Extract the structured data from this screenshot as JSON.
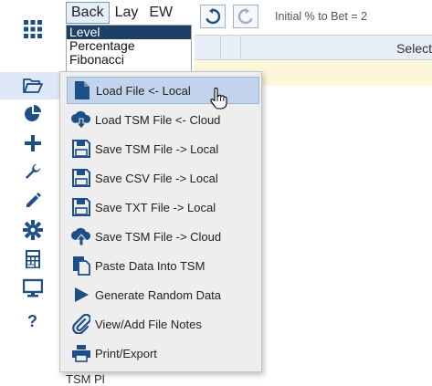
{
  "tabs": [
    {
      "label": "Back"
    },
    {
      "label": "Lay"
    },
    {
      "label": "EW"
    }
  ],
  "strategies": [
    "Level",
    "Percentage",
    "Fibonacci"
  ],
  "toolbar": {
    "initial_bet_label": "Initial % to Bet = 2"
  },
  "grid": {
    "header_select": "Select"
  },
  "menu": {
    "items": [
      {
        "label": "Load File <- Local",
        "icon": "file-icon"
      },
      {
        "label": "Load TSM File <- Cloud",
        "icon": "cloud-download-icon"
      },
      {
        "label": "Save TSM File -> Local",
        "icon": "floppy-icon"
      },
      {
        "label": "Save CSV File -> Local",
        "icon": "floppy-icon"
      },
      {
        "label": "Save TXT File -> Local",
        "icon": "floppy-icon"
      },
      {
        "label": "Save TSM File -> Cloud",
        "icon": "cloud-upload-icon"
      },
      {
        "label": "Paste Data Into TSM",
        "icon": "paste-icon"
      },
      {
        "label": "Generate Random Data",
        "icon": "play-icon"
      },
      {
        "label": "View/Add File Notes",
        "icon": "paperclip-icon"
      },
      {
        "label": "Print/Export",
        "icon": "printer-icon"
      }
    ]
  },
  "bottom_stub": "TSM Pl",
  "colors": {
    "icon_blue": "#1d4f86",
    "accent_selected": "#1e3f66",
    "menu_hover": "#c2d4ec"
  }
}
